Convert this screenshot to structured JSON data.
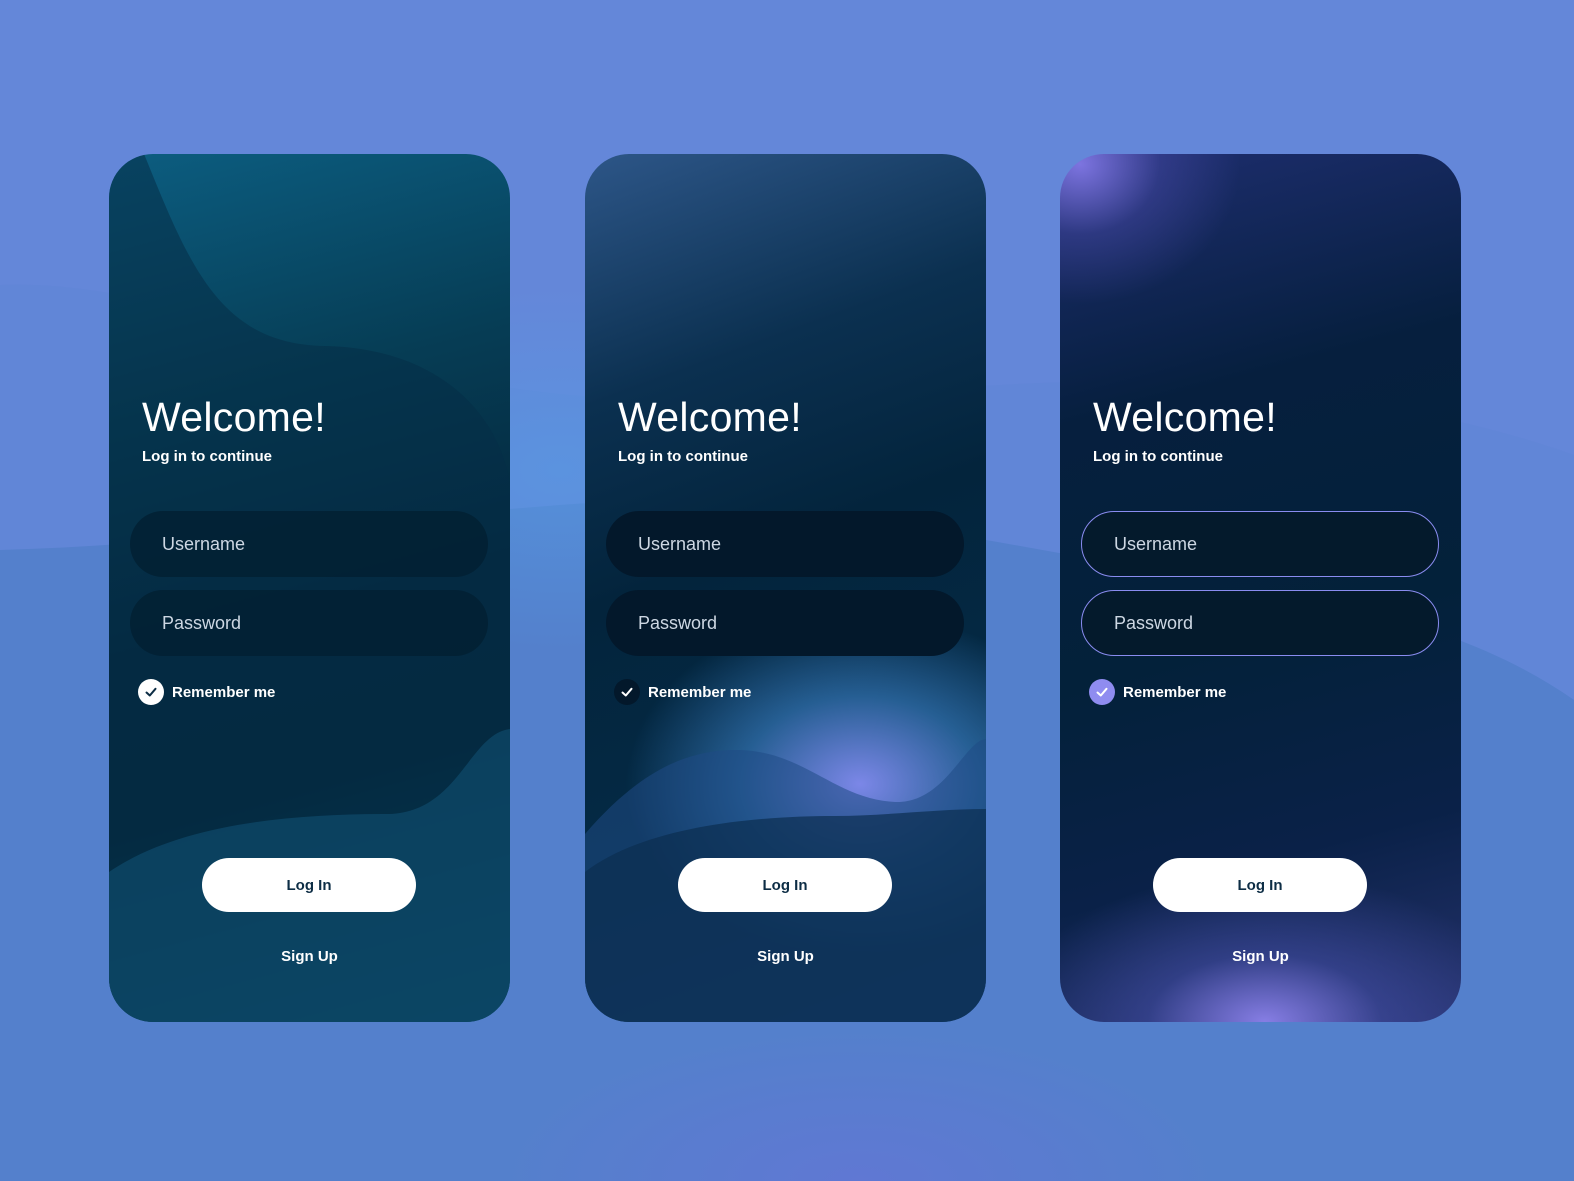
{
  "cards": [
    {
      "title": "Welcome!",
      "subtitle": "Log in to continue",
      "username_placeholder": "Username",
      "password_placeholder": "Password",
      "remember_label": "Remember me",
      "login_label": "Log In",
      "signup_label": "Sign Up",
      "accent_color": "#0c5d80"
    },
    {
      "title": "Welcome!",
      "subtitle": "Log in to continue",
      "username_placeholder": "Username",
      "password_placeholder": "Password",
      "remember_label": "Remember me",
      "login_label": "Log In",
      "signup_label": "Sign Up",
      "accent_color": "#828cf0"
    },
    {
      "title": "Welcome!",
      "subtitle": "Log in to continue",
      "username_placeholder": "Username",
      "password_placeholder": "Password",
      "remember_label": "Remember me",
      "login_label": "Log In",
      "signup_label": "Sign Up",
      "accent_color": "#8f8cf0"
    }
  ],
  "icons": {
    "check": "check-icon"
  },
  "colors": {
    "background": "#6487d9",
    "button": "#ffffff",
    "button_text": "#0d2d45"
  }
}
